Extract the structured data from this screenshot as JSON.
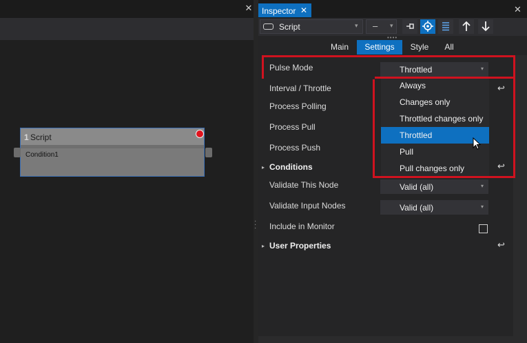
{
  "canvas": {
    "close_glyph": "✕",
    "node": {
      "number": "1",
      "title": "Script",
      "condition": "Condition1"
    }
  },
  "inspector": {
    "tab_label": "Inspector",
    "tab_close_glyph": "✕",
    "panel_close_glyph": "✕",
    "type_label": "Script",
    "minus_label": "–",
    "section_tabs": [
      "Main",
      "Settings",
      "Style",
      "All"
    ],
    "active_section": "Settings"
  },
  "properties": {
    "pulse_mode": {
      "label": "Pulse Mode",
      "value": "Throttled"
    },
    "interval_throttle": {
      "label": "Interval / Throttle"
    },
    "process_polling": {
      "label": "Process Polling"
    },
    "process_pull": {
      "label": "Process Pull"
    },
    "process_push": {
      "label": "Process Push"
    },
    "conditions_group": {
      "label": "Conditions"
    },
    "validate_this_node": {
      "label": "Validate This Node",
      "value": "Valid (all)"
    },
    "validate_input_nodes": {
      "label": "Validate Input Nodes",
      "value": "Valid (all)"
    },
    "include_in_monitor": {
      "label": "Include in Monitor",
      "checked": false
    },
    "user_properties_group": {
      "label": "User Properties"
    }
  },
  "dropdown": {
    "options": [
      "Always",
      "Changes only",
      "Throttled changes only",
      "Throttled",
      "Pull",
      "Pull changes only"
    ],
    "selected": "Throttled"
  },
  "icons": {
    "reset": "↩",
    "expand": "▸",
    "dropdown_arrow": "▾"
  },
  "colors": {
    "accent": "#0e70c0",
    "highlight": "#d0121f",
    "node_status": "#e0141e"
  }
}
